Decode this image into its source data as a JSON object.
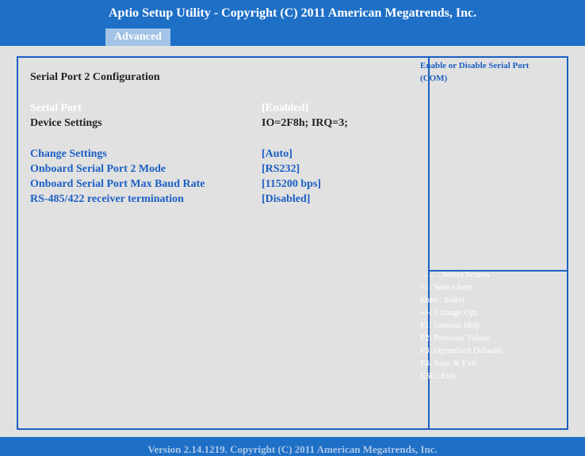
{
  "header": {
    "title": "Aptio Setup Utility - Copyright (C) 2011 American Megatrends, Inc.",
    "tab": "Advanced"
  },
  "content": {
    "section_title": "Serial Port 2 Configuration",
    "rows": [
      {
        "label": "Serial Port",
        "value": "[Enabled]"
      },
      {
        "label": "Device Settings",
        "value": "IO=2F8h; IRQ=3;"
      },
      {
        "label": "Change Settings",
        "value": "[Auto]"
      },
      {
        "label": "Onboard Serial Port 2 Mode",
        "value": "[RS232]"
      },
      {
        "label": "Onboard Serial Port Max Baud Rate",
        "value": "[115200 bps]"
      },
      {
        "label": "RS-485/422 receiver termination",
        "value": "[Disabled]"
      }
    ]
  },
  "help": {
    "text": "Enable or Disable Serial Port (COM)"
  },
  "keys": [
    "→←: Select Screen",
    "↑↓: Select Item",
    "Enter: Select",
    "+/-: Change Opt.",
    "F1: General Help",
    "F2: Previous Values",
    "F3: Optimized Defaults",
    "F4: Save & Exit",
    "ESC: Exit"
  ],
  "footer": {
    "text": "Version 2.14.1219. Copyright (C) 2011 American Megatrends, Inc."
  },
  "colors": {
    "header_bg": "#1e6fc6",
    "panel_bg": "#e1e1e1",
    "accent_blue": "#1b5fc4",
    "selected_text": "#ffffff"
  }
}
